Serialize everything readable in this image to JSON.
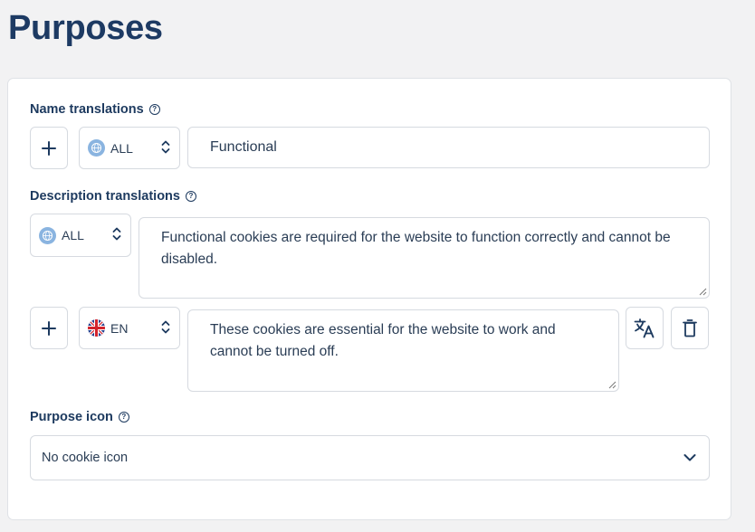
{
  "page": {
    "title": "Purposes"
  },
  "name_translations": {
    "label": "Name translations",
    "help": "?",
    "language": "ALL",
    "value": "Functional"
  },
  "description_translations": {
    "label": "Description translations",
    "help": "?",
    "rows": [
      {
        "language": "ALL",
        "value": "Functional cookies are required for the website to function correctly and cannot be disabled."
      },
      {
        "language": "EN",
        "value": "These cookies are essential for the website to work and cannot be turned off."
      }
    ]
  },
  "purpose_icon": {
    "label": "Purpose icon",
    "help": "?",
    "selected": "No cookie icon"
  },
  "icons": [
    "plus-icon",
    "globe-icon",
    "uk-flag-icon",
    "updown-icon",
    "translate-icon",
    "trash-icon",
    "chevron-down-icon",
    "help-icon",
    "resize-icon"
  ]
}
